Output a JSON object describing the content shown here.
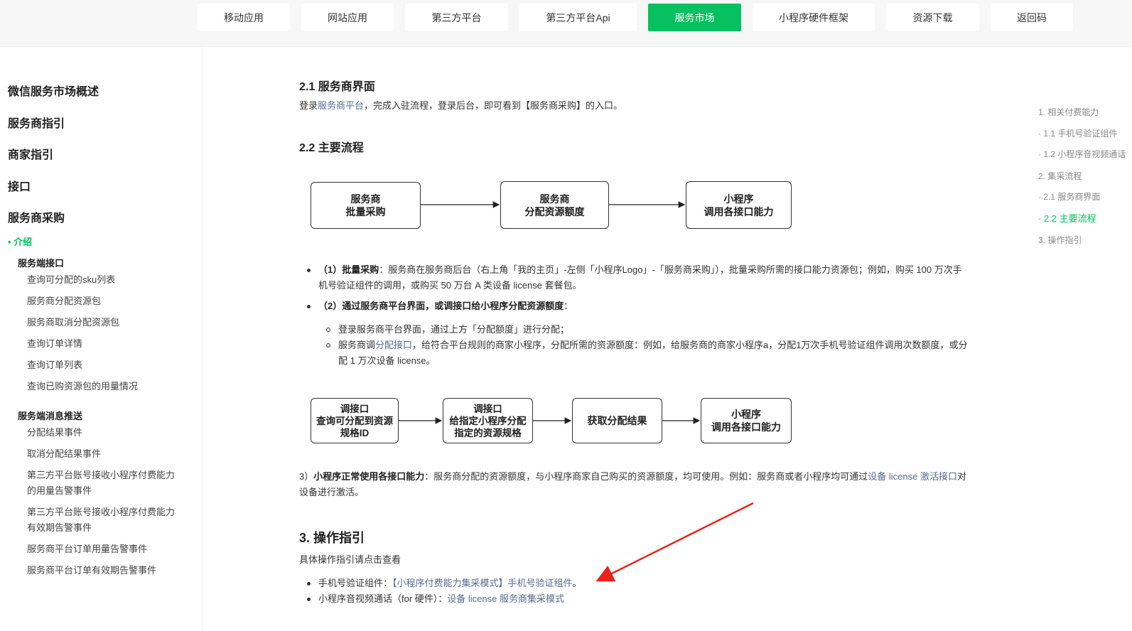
{
  "topnav": {
    "items": [
      {
        "label": "移动应用"
      },
      {
        "label": "网站应用"
      },
      {
        "label": "第三方平台"
      },
      {
        "label": "第三方平台Api"
      },
      {
        "label": "服务市场",
        "active": true
      },
      {
        "label": "小程序硬件框架"
      },
      {
        "label": "资源下载"
      },
      {
        "label": "返回码"
      }
    ]
  },
  "sidebar": {
    "sections": [
      "微信服务市场概述",
      "服务商指引",
      "商家指引",
      "接口",
      "服务商采购"
    ],
    "active": "• 介绍",
    "group1": {
      "title": "服务端接口",
      "items": [
        "查询可分配的sku列表",
        "服务商分配资源包",
        "服务商取消分配资源包",
        "查询订单详情",
        "查询订单列表",
        "查询已购资源包的用量情况"
      ]
    },
    "group2": {
      "title": "服务端消息推送",
      "items": [
        "分配结果事件",
        "取消分配结果事件",
        "第三方平台账号接收小程序付费能力的用量告警事件",
        "第三方平台账号接收小程序付费能力有效期告警事件",
        "服务商平台订单用量告警事件",
        "服务商平台订单有效期告警事件"
      ]
    }
  },
  "main": {
    "sec21": {
      "title": "2.1 服务商界面",
      "p_a": "登录",
      "p_link": "服务商平台",
      "p_b": "，完成入驻流程，登录后台，即可看到【服务商采购】的入口。"
    },
    "sec22": {
      "title": "2.2 主要流程",
      "flow1": [
        "服务商\n批量采购",
        "服务商\n分配资源额度",
        "小程序\n调用各接口能力"
      ],
      "b1_bold": "（1）批量采购",
      "b1_text": "：服务商在服务商后台（右上角「我的主页」-左侧「小程序Logo」-「服务商采购」），批量采购所需的接口能力资源包；例如，购买 100 万次手机号验证组件的调用，或购买 50 万台 A 类设备 license 套餐包。",
      "b2_bold_a": "（2）通过",
      "b2_link": "服务商平台界面",
      "b2_bold_b": "，或调接口给小程序分配资源额度",
      "b2_tail": "：",
      "s1": "登录服务商平台界面，通过上方「分配额度」进行分配；",
      "s2_a": "服务商调",
      "s2_link": "分配接口",
      "s2_b": "，给符合平台规则的商家小程序，分配所需的资源额度：例如，给服务商的商家小程序a，分配1万次手机号验证组件调用次数额度，或分配 1 万次设备 license。",
      "flow2": [
        "调接口\n查询可分配到资源\n规格ID",
        "调接口\n给指定小程序分配\n指定的资源规格",
        "获取分配结果",
        "小程序\n调用各接口能力"
      ],
      "p3_a": "3）",
      "p3_bold": "小程序正常使用各接口能力",
      "p3_b": "：服务商分配的资源额度，与小程序商家自己购买的资源额度，均可使用。例如：服务商或者小程序均可通过",
      "p3_link": "设备 license 激活接口",
      "p3_c": "对设备进行激活。"
    },
    "sec3": {
      "title": "3. 操作指引",
      "intro": "具体操作指引请点击查看",
      "i1_a": "手机号验证组件：",
      "i1_link": "【小程序付费能力集采模式】手机号验证组件",
      "i1_b": "。",
      "i2_a": "小程序音视频通话（for 硬件）：",
      "i2_link": "设备 license 服务商集采模式"
    }
  },
  "toc": {
    "items": [
      "1. 相关付费能力",
      "· 1.1 手机号验证组件",
      "· 1.2 小程序音视频通话",
      "2. 集采流程",
      "· 2.1 服务商界面",
      "· 2.2 主要流程",
      "3. 操作指引"
    ],
    "active_index": 5
  },
  "colors": {
    "accent": "#07c160",
    "link": "#576b95",
    "arrow": "#e8231b"
  }
}
